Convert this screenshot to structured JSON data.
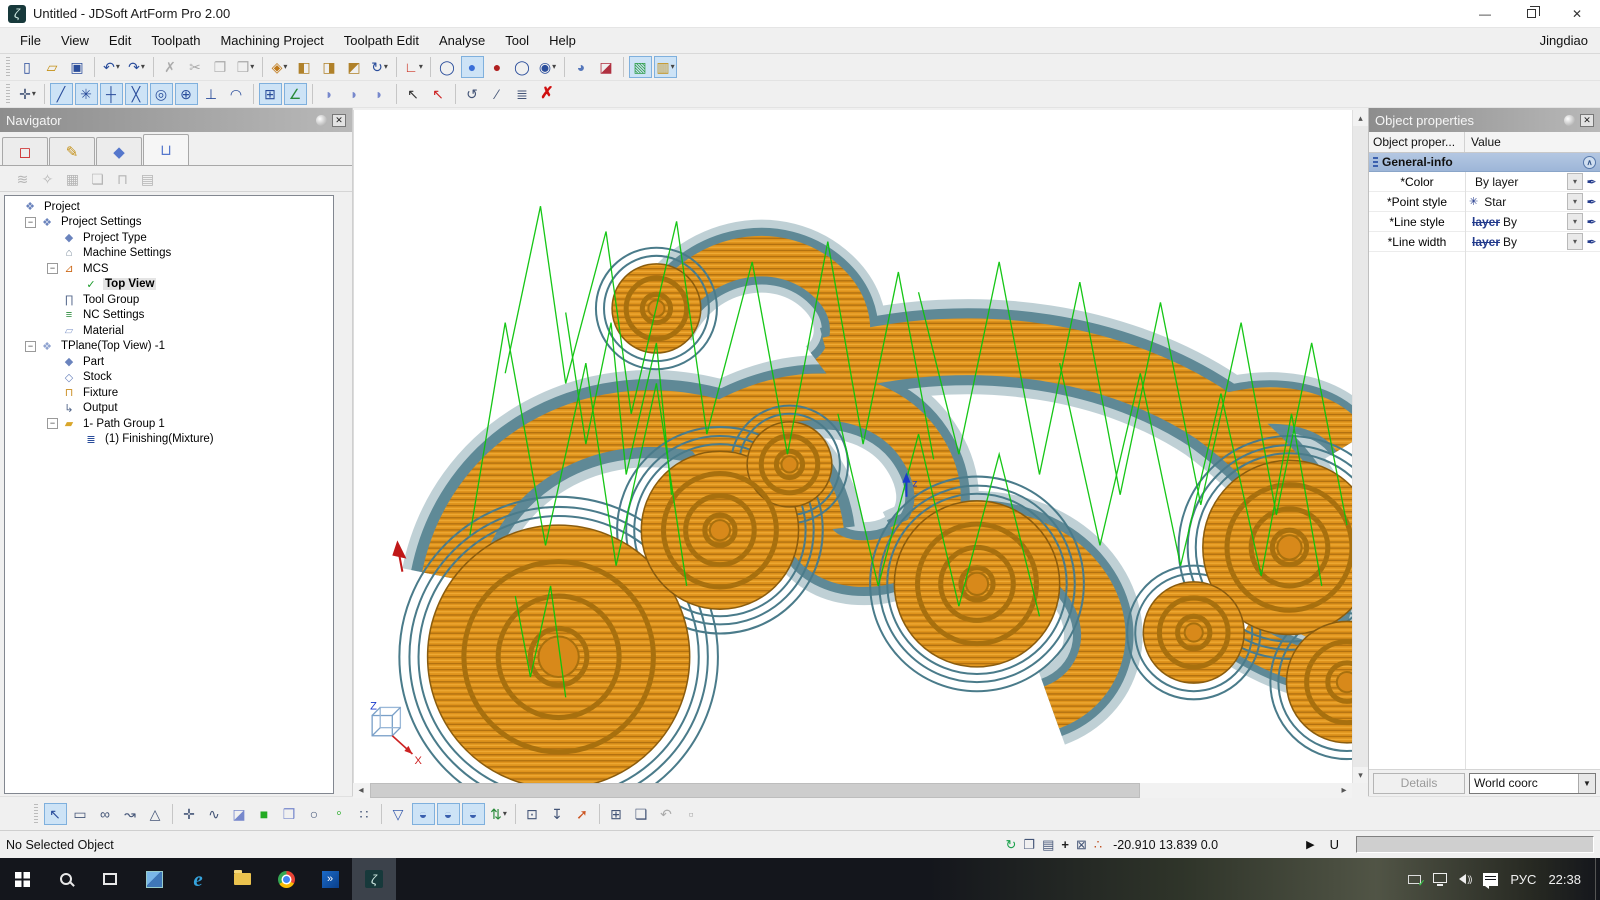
{
  "window": {
    "title": "Untitled - JDSoft ArtForm Pro 2.00",
    "brand": "Jingdiao",
    "logo_glyph": "ζ",
    "min": "—",
    "close": "✕"
  },
  "menubar": {
    "items": [
      "File",
      "View",
      "Edit",
      "Toolpath",
      "Machining Project",
      "Toolpath Edit",
      "Analyse",
      "Tool",
      "Help"
    ]
  },
  "toolbar1": [
    {
      "n": "toolbar-grip",
      "c": "grip",
      "g": "",
      "d": "",
      "s": "",
      "i": "false"
    },
    {
      "n": "new-button",
      "c": "",
      "g": "▯",
      "d": "",
      "s": "color:#2a4d9b",
      "i": "true"
    },
    {
      "n": "open-button",
      "c": "",
      "g": "▱",
      "d": "",
      "s": "color:#c49016",
      "i": "true"
    },
    {
      "n": "save-button",
      "c": "",
      "g": "▣",
      "d": "",
      "s": "color:#2a4d9b",
      "i": "true"
    },
    {
      "n": "separator",
      "c": "sep",
      "g": "",
      "d": "",
      "s": "",
      "i": "false"
    },
    {
      "n": "undo-button",
      "c": "",
      "g": "↶",
      "d": "▾",
      "s": "color:#2a4d9b",
      "i": "true"
    },
    {
      "n": "redo-button",
      "c": "",
      "g": "↷",
      "d": "▾",
      "s": "color:#2a4d9b",
      "i": "true"
    },
    {
      "n": "separator",
      "c": "sep",
      "g": "",
      "d": "",
      "s": "",
      "i": "false"
    },
    {
      "n": "delete-button",
      "c": "",
      "g": "✗",
      "d": "",
      "s": "color:#ababab",
      "i": "true"
    },
    {
      "n": "cut-button",
      "c": "",
      "g": "✂",
      "d": "",
      "s": "color:#ababab",
      "i": "true"
    },
    {
      "n": "copy-button",
      "c": "",
      "g": "❐",
      "d": "",
      "s": "color:#ababab",
      "i": "true"
    },
    {
      "n": "paste-button",
      "c": "",
      "g": "❒",
      "d": "▾",
      "s": "color:#ababab",
      "i": "true"
    },
    {
      "n": "separator",
      "c": "sep",
      "g": "",
      "d": "",
      "s": "",
      "i": "false"
    },
    {
      "n": "view-cube-button",
      "c": "",
      "g": "◈",
      "d": "▾",
      "s": "color:#c07a1a",
      "i": "true"
    },
    {
      "n": "iso-view-1-button",
      "c": "",
      "g": "◧",
      "d": "",
      "s": "color:#b0812a",
      "i": "true"
    },
    {
      "n": "iso-view-2-button",
      "c": "",
      "g": "◨",
      "d": "",
      "s": "color:#b0812a",
      "i": "true"
    },
    {
      "n": "iso-view-3-button",
      "c": "",
      "g": "◩",
      "d": "",
      "s": "color:#b0812a",
      "i": "true"
    },
    {
      "n": "rotate-view-button",
      "c": "",
      "g": "↻",
      "d": "▾",
      "s": "color:#2a4d9b",
      "i": "true"
    },
    {
      "n": "separator",
      "c": "sep",
      "g": "",
      "d": "",
      "s": "",
      "i": "false"
    },
    {
      "n": "coordinate-system-button",
      "c": "",
      "g": "∟",
      "d": "▾",
      "s": "color:#cc3322",
      "i": "true"
    },
    {
      "n": "separator",
      "c": "sep",
      "g": "",
      "d": "",
      "s": "",
      "i": "false"
    },
    {
      "n": "wireframe-mode-button",
      "c": "",
      "g": "◯",
      "d": "",
      "s": "color:#2a4d9b",
      "i": "true"
    },
    {
      "n": "shaded-mode-button",
      "c": "boxed",
      "g": "●",
      "d": "",
      "s": "color:#3a6fd8",
      "i": "true"
    },
    {
      "n": "shaded-edges-mode-button",
      "c": "",
      "g": "●",
      "d": "",
      "s": "color:#b02020",
      "i": "true"
    },
    {
      "n": "hidden-line-mode-button",
      "c": "",
      "g": "◯",
      "d": "",
      "s": "color:#2a4d9b",
      "i": "true"
    },
    {
      "n": "mixed-mode-button",
      "c": "",
      "g": "◉",
      "d": "▾",
      "s": "color:#2a4d9b",
      "i": "true"
    },
    {
      "n": "separator",
      "c": "sep",
      "g": "",
      "d": "",
      "s": "",
      "i": "false"
    },
    {
      "n": "render-material-button",
      "c": "",
      "g": "◕",
      "d": "",
      "s": "color:#5577bb",
      "i": "true"
    },
    {
      "n": "section-view-button",
      "c": "",
      "g": "◪",
      "d": "",
      "s": "color:#b03040",
      "i": "true"
    },
    {
      "n": "separator",
      "c": "sep",
      "g": "",
      "d": "",
      "s": "",
      "i": "false"
    },
    {
      "n": "toolpath-display-button",
      "c": "boxed",
      "g": "▧",
      "d": "",
      "s": "color:#2f9e48",
      "i": "true"
    },
    {
      "n": "analysis-display-button",
      "c": "boxed",
      "g": "▥",
      "d": "▾",
      "s": "color:#c49016",
      "i": "true"
    }
  ],
  "toolbar2": [
    {
      "n": "toolbar-grip",
      "c": "grip",
      "g": "",
      "d": "",
      "s": "",
      "i": "false"
    },
    {
      "n": "pan-points-button",
      "c": "",
      "g": "✛",
      "d": "▾",
      "s": "color:#445577",
      "i": "true"
    },
    {
      "n": "separator",
      "c": "sep",
      "g": "",
      "d": "",
      "s": "",
      "i": "false"
    },
    {
      "n": "snap-line-button",
      "c": "boxed",
      "g": "╱",
      "d": "",
      "s": "color:#2a4d9b",
      "i": "true"
    },
    {
      "n": "snap-point-button",
      "c": "boxed",
      "g": "✳",
      "d": "",
      "s": "color:#2a4d9b",
      "i": "true"
    },
    {
      "n": "snap-midpoint-button",
      "c": "boxed",
      "g": "┼",
      "d": "",
      "s": "color:#2a4d9b",
      "i": "true"
    },
    {
      "n": "snap-intersection-button",
      "c": "boxed",
      "g": "╳",
      "d": "",
      "s": "color:#2a4d9b",
      "i": "true"
    },
    {
      "n": "snap-center-button",
      "c": "boxed",
      "g": "◎",
      "d": "",
      "s": "color:#2a4d9b",
      "i": "true"
    },
    {
      "n": "snap-quadrant-button",
      "c": "boxed",
      "g": "⊕",
      "d": "",
      "s": "color:#2a4d9b",
      "i": "true"
    },
    {
      "n": "snap-perpendicular-button",
      "c": "",
      "g": "⊥",
      "d": "",
      "s": "color:#2a4d9b",
      "i": "true"
    },
    {
      "n": "snap-tangent-button",
      "c": "",
      "g": "◠",
      "d": "",
      "s": "color:#2a4d9b",
      "i": "true"
    },
    {
      "n": "separator",
      "c": "sep",
      "g": "",
      "d": "",
      "s": "",
      "i": "false"
    },
    {
      "n": "grid-toggle-button",
      "c": "boxed",
      "g": "⊞",
      "d": "",
      "s": "color:#2a4d9b",
      "i": "true"
    },
    {
      "n": "ucs-toggle-button",
      "c": "boxed",
      "g": "∠",
      "d": "",
      "s": "color:#2a8a3a",
      "i": "true"
    },
    {
      "n": "separator",
      "c": "sep",
      "g": "",
      "d": "",
      "s": "",
      "i": "false"
    },
    {
      "n": "surface-view-1-button",
      "c": "",
      "g": "◗",
      "d": "",
      "s": "color:#7788cc",
      "i": "true"
    },
    {
      "n": "surface-view-2-button",
      "c": "",
      "g": "◗",
      "d": "",
      "s": "color:#7788cc",
      "i": "true"
    },
    {
      "n": "surface-view-3-button",
      "c": "",
      "g": "◗",
      "d": "",
      "s": "color:#7788cc",
      "i": "true"
    },
    {
      "n": "separator",
      "c": "sep",
      "g": "",
      "d": "",
      "s": "",
      "i": "false"
    },
    {
      "n": "pick-add-button",
      "c": "",
      "g": "↖",
      "d": "",
      "s": "color:#333333",
      "i": "true"
    },
    {
      "n": "pick-remove-button",
      "c": "",
      "g": "↖",
      "d": "",
      "s": "color:#cc2222",
      "i": "true"
    },
    {
      "n": "separator",
      "c": "sep",
      "g": "",
      "d": "",
      "s": "",
      "i": "false"
    },
    {
      "n": "object-rotate-button",
      "c": "",
      "g": "↺",
      "d": "",
      "s": "color:#445577",
      "i": "true"
    },
    {
      "n": "object-trim-button",
      "c": "",
      "g": "⁄",
      "d": "",
      "s": "color:#445577",
      "i": "true"
    },
    {
      "n": "object-list-button",
      "c": "",
      "g": "≣",
      "d": "",
      "s": "color:#445577",
      "i": "true"
    },
    {
      "n": "cancel-button",
      "c": "",
      "g": "✗",
      "d": "",
      "s": "color:#d01010;font-weight:bold;font-size:16px",
      "i": "true"
    }
  ],
  "bottombar": [
    {
      "n": "toolbar-grip",
      "c": "grip",
      "g": "",
      "d": "",
      "s": "",
      "i": "false"
    },
    {
      "n": "select-button",
      "c": "boxed",
      "g": "↖",
      "d": "",
      "s": "color:#2a4d9b",
      "i": "true"
    },
    {
      "n": "marquee-select-button",
      "c": "",
      "g": "▭",
      "d": "",
      "s": "color:#445577",
      "i": "true"
    },
    {
      "n": "chain-select-button",
      "c": "",
      "g": "∞",
      "d": "",
      "s": "color:#445577",
      "i": "true"
    },
    {
      "n": "curve-pick-button",
      "c": "",
      "g": "↝",
      "d": "",
      "s": "color:#445577",
      "i": "true"
    },
    {
      "n": "polygon-select-button",
      "c": "",
      "g": "△",
      "d": "",
      "s": "color:#445577",
      "i": "true"
    },
    {
      "n": "separator",
      "c": "sep",
      "g": "",
      "d": "",
      "s": "",
      "i": "false"
    },
    {
      "n": "add-point-button",
      "c": "",
      "g": "✛",
      "d": "",
      "s": "color:#445577",
      "i": "true"
    },
    {
      "n": "draw-curve-button",
      "c": "",
      "g": "∿",
      "d": "",
      "s": "color:#445577",
      "i": "true"
    },
    {
      "n": "erase-area-button",
      "c": "",
      "g": "◪",
      "d": "",
      "s": "color:#7788cc",
      "i": "true"
    },
    {
      "n": "fill-region-button",
      "c": "",
      "g": "■",
      "d": "",
      "s": "color:#22aa22",
      "i": "true"
    },
    {
      "n": "match-surface-button",
      "c": "",
      "g": "❒",
      "d": "",
      "s": "color:#7788cc",
      "i": "true"
    },
    {
      "n": "circle-point-button",
      "c": "",
      "g": "○",
      "d": "",
      "s": "color:#445577",
      "i": "true"
    },
    {
      "n": "green-point-button",
      "c": "",
      "g": "◦",
      "d": "",
      "s": "color:#22aa22;font-size:16px",
      "i": "true"
    },
    {
      "n": "point-array-button",
      "c": "",
      "g": "∷",
      "d": "",
      "s": "color:#445577",
      "i": "true"
    },
    {
      "n": "separator",
      "c": "sep",
      "g": "",
      "d": "",
      "s": "",
      "i": "false"
    },
    {
      "n": "tool-cone-button",
      "c": "",
      "g": "▽",
      "d": "",
      "s": "color:#3a5fae",
      "i": "true"
    },
    {
      "n": "tool-ball-button",
      "c": "boxed",
      "g": "◒",
      "d": "",
      "s": "color:#3a5fae",
      "i": "true"
    },
    {
      "n": "tool-flat-button",
      "c": "boxed",
      "g": "◒",
      "d": "",
      "s": "color:#3a5fae",
      "i": "true"
    },
    {
      "n": "tool-taper-button",
      "c": "boxed",
      "g": "◒",
      "d": "",
      "s": "color:#3a5fae",
      "i": "true"
    },
    {
      "n": "sort-paths-button",
      "c": "",
      "g": "⇅",
      "d": "▾",
      "s": "color:#2a8a3a",
      "i": "true"
    },
    {
      "n": "separator",
      "c": "sep",
      "g": "",
      "d": "",
      "s": "",
      "i": "false"
    },
    {
      "n": "capture-region-button",
      "c": "",
      "g": "⊡",
      "d": "",
      "s": "color:#445577",
      "i": "true"
    },
    {
      "n": "z-select-button",
      "c": "",
      "g": "↧",
      "d": "",
      "s": "color:#445577",
      "i": "true"
    },
    {
      "n": "transform-path-button",
      "c": "",
      "g": "➚",
      "d": "",
      "s": "color:#cc5522",
      "i": "true"
    },
    {
      "n": "separator",
      "c": "sep",
      "g": "",
      "d": "",
      "s": "",
      "i": "false"
    },
    {
      "n": "cell-box-button",
      "c": "",
      "g": "⊞",
      "d": "",
      "s": "color:#445577",
      "i": "true"
    },
    {
      "n": "frame-box-button",
      "c": "",
      "g": "❏",
      "d": "",
      "s": "color:#445577",
      "i": "true"
    },
    {
      "n": "undo-edit-button",
      "c": "",
      "g": "↶",
      "d": "",
      "s": "color:#ababab",
      "i": "true"
    },
    {
      "n": "region-gray-button",
      "c": "",
      "g": "▫",
      "d": "",
      "s": "color:#ababab",
      "i": "true"
    }
  ],
  "navigator": {
    "title": "Navigator",
    "tabs": [
      {
        "n": "tab-artwork",
        "g": "◻",
        "s": "color:#cc2222",
        "c": ""
      },
      {
        "n": "tab-drawing",
        "g": "✎",
        "s": "color:#c49016",
        "c": ""
      },
      {
        "n": "tab-relief",
        "g": "◆",
        "s": "color:#5577cc",
        "c": ""
      },
      {
        "n": "tab-machining",
        "g": "⊔",
        "s": "color:#5577cc",
        "c": "active"
      }
    ],
    "tools": [
      {
        "n": "ref-toolpath-icon",
        "g": "≋",
        "s": "",
        "i": "false"
      },
      {
        "n": "simulate-icon",
        "g": "✧",
        "s": "",
        "i": "false"
      },
      {
        "n": "sheet-icon",
        "g": "▦",
        "s": "",
        "i": "false"
      },
      {
        "n": "layers-icon",
        "g": "❏",
        "s": "",
        "i": "false"
      },
      {
        "n": "tool-icon",
        "g": "⊓",
        "s": "",
        "i": "false"
      },
      {
        "n": "report-icon",
        "g": "▤",
        "s": "",
        "i": "false"
      }
    ],
    "tree": [
      {
        "n": "tree-project",
        "label": "Project",
        "exp": "",
        "g": "❖",
        "gs": "color:#6a83bd",
        "ind": "i0",
        "lc": ""
      },
      {
        "n": "tree-project-settings",
        "label": "Project Settings",
        "exp": "−",
        "g": "❖",
        "gs": "color:#6a83bd",
        "ind": "i1",
        "lc": ""
      },
      {
        "n": "tree-project-type",
        "label": "Project Type",
        "exp": "",
        "g": "◆",
        "gs": "color:#6a83bd",
        "ind": "i2",
        "lc": ""
      },
      {
        "n": "tree-machine-settings",
        "label": "Machine Settings",
        "exp": "",
        "g": "⌂",
        "gs": "color:#778899",
        "ind": "i2",
        "lc": ""
      },
      {
        "n": "tree-mcs",
        "label": "MCS",
        "exp": "−",
        "g": "⊿",
        "gs": "color:#cc6a1a",
        "ind": "i2",
        "lc": ""
      },
      {
        "n": "tree-top-view",
        "label": "Top View",
        "exp": "",
        "g": "✓",
        "gs": "color:#1a9a2a",
        "ind": "i3",
        "lc": "sel"
      },
      {
        "n": "tree-tool-group",
        "label": "Tool Group",
        "exp": "",
        "g": "∏",
        "gs": "color:#55688c",
        "ind": "i2",
        "lc": ""
      },
      {
        "n": "tree-nc-settings",
        "label": "NC Settings",
        "exp": "",
        "g": "≡",
        "gs": "color:#2a8a3a",
        "ind": "i2",
        "lc": ""
      },
      {
        "n": "tree-material",
        "label": "Material",
        "exp": "",
        "g": "▱",
        "gs": "color:#8fa3d0",
        "ind": "i2",
        "lc": ""
      },
      {
        "n": "tree-tplane",
        "label": "TPlane(Top View) -1",
        "exp": "−",
        "g": "❖",
        "gs": "color:#8fa3d0",
        "ind": "i1",
        "lc": ""
      },
      {
        "n": "tree-part",
        "label": "Part",
        "exp": "",
        "g": "◆",
        "gs": "color:#6a83bd",
        "ind": "i2",
        "lc": ""
      },
      {
        "n": "tree-stock",
        "label": "Stock",
        "exp": "",
        "g": "◇",
        "gs": "color:#6a83bd",
        "ind": "i2",
        "lc": ""
      },
      {
        "n": "tree-fixture",
        "label": "Fixture",
        "exp": "",
        "g": "⊓",
        "gs": "color:#c98c1e",
        "ind": "i2",
        "lc": ""
      },
      {
        "n": "tree-output",
        "label": "Output",
        "exp": "",
        "g": "↳",
        "gs": "color:#55688c",
        "ind": "i2",
        "lc": ""
      },
      {
        "n": "tree-path-group",
        "label": "1- Path Group 1",
        "exp": "−",
        "g": "▰",
        "gs": "color:#d9a62a",
        "ind": "i2",
        "lc": ""
      },
      {
        "n": "tree-finishing",
        "label": "(1) Finishing(Mixture)",
        "exp": "",
        "g": "≣",
        "gs": "color:#2a4d9b",
        "ind": "i3",
        "lc": ""
      }
    ]
  },
  "properties": {
    "title": "Object properties",
    "col1": "Object proper...",
    "col2": "Value",
    "group": "General-info",
    "collapse_glyph": "∧",
    "rows": [
      {
        "n": "prop-color",
        "label": "*Color",
        "pre": "",
        "sample": "",
        "value": "By layer",
        "d": "▾",
        "f": "✒"
      },
      {
        "n": "prop-point-style",
        "label": "*Point style",
        "pre": "✳",
        "sample": "",
        "value": "Star",
        "d": "▾",
        "f": "✒"
      },
      {
        "n": "prop-line-style",
        "label": "*Line style",
        "pre": "",
        "sample": "layer",
        "value": "By",
        "d": "▾",
        "f": "✒"
      },
      {
        "n": "prop-line-width",
        "label": "*Line width",
        "pre": "",
        "sample": "layer",
        "value": "By",
        "d": "▾",
        "f": "✒"
      }
    ],
    "details_label": "Details",
    "coord_value": "World coorc"
  },
  "viewport": {
    "scroll_up": "▴",
    "scroll_down": "▾",
    "scroll_left": "◂",
    "scroll_right": "▸"
  },
  "statusbar": {
    "message": "No Selected Object",
    "icons": [
      {
        "n": "refresh-icon",
        "g": "↻",
        "s": "color:#18a04a",
        "i": "true"
      },
      {
        "n": "copy-doc-icon",
        "g": "❐",
        "s": "color:#445577",
        "i": "true"
      },
      {
        "n": "print-icon",
        "g": "▤",
        "s": "color:#445577",
        "i": "true"
      },
      {
        "n": "add-icon",
        "g": "+",
        "s": "color:#222222;font-weight:bold",
        "i": "true"
      },
      {
        "n": "no-image-icon",
        "g": "⊠",
        "s": "color:#445577",
        "i": "true"
      },
      {
        "n": "measure-icon",
        "g": "∴",
        "s": "color:#c05020",
        "i": "true"
      }
    ],
    "coords": "-20.910 13.839 0.0",
    "play": "▶",
    "unit": "U"
  },
  "taskbar": {
    "apps": [
      {
        "n": "start-button",
        "c": "",
        "ic": "tk-start",
        "g": ""
      },
      {
        "n": "search-button",
        "c": "",
        "ic": "tk-search",
        "g": ""
      },
      {
        "n": "task-view-button",
        "c": "",
        "ic": "tk-taskview",
        "g": ""
      },
      {
        "n": "photos-app-button",
        "c": "",
        "ic": "tk-photos",
        "g": ""
      },
      {
        "n": "edge-button",
        "c": "",
        "ic": "tk-edge",
        "g": "e"
      },
      {
        "n": "explorer-button",
        "c": "",
        "ic": "tk-explorer",
        "g": ""
      },
      {
        "n": "chrome-button",
        "c": "",
        "ic": "tk-chrome",
        "g": ""
      },
      {
        "n": "jdpaint-button",
        "c": "",
        "ic": "tk-jdapp",
        "g": "»"
      },
      {
        "n": "artform-button",
        "c": "active",
        "ic": "tk-artform",
        "g": "ζ"
      }
    ],
    "lang": "РУС",
    "clock": "22:38"
  }
}
